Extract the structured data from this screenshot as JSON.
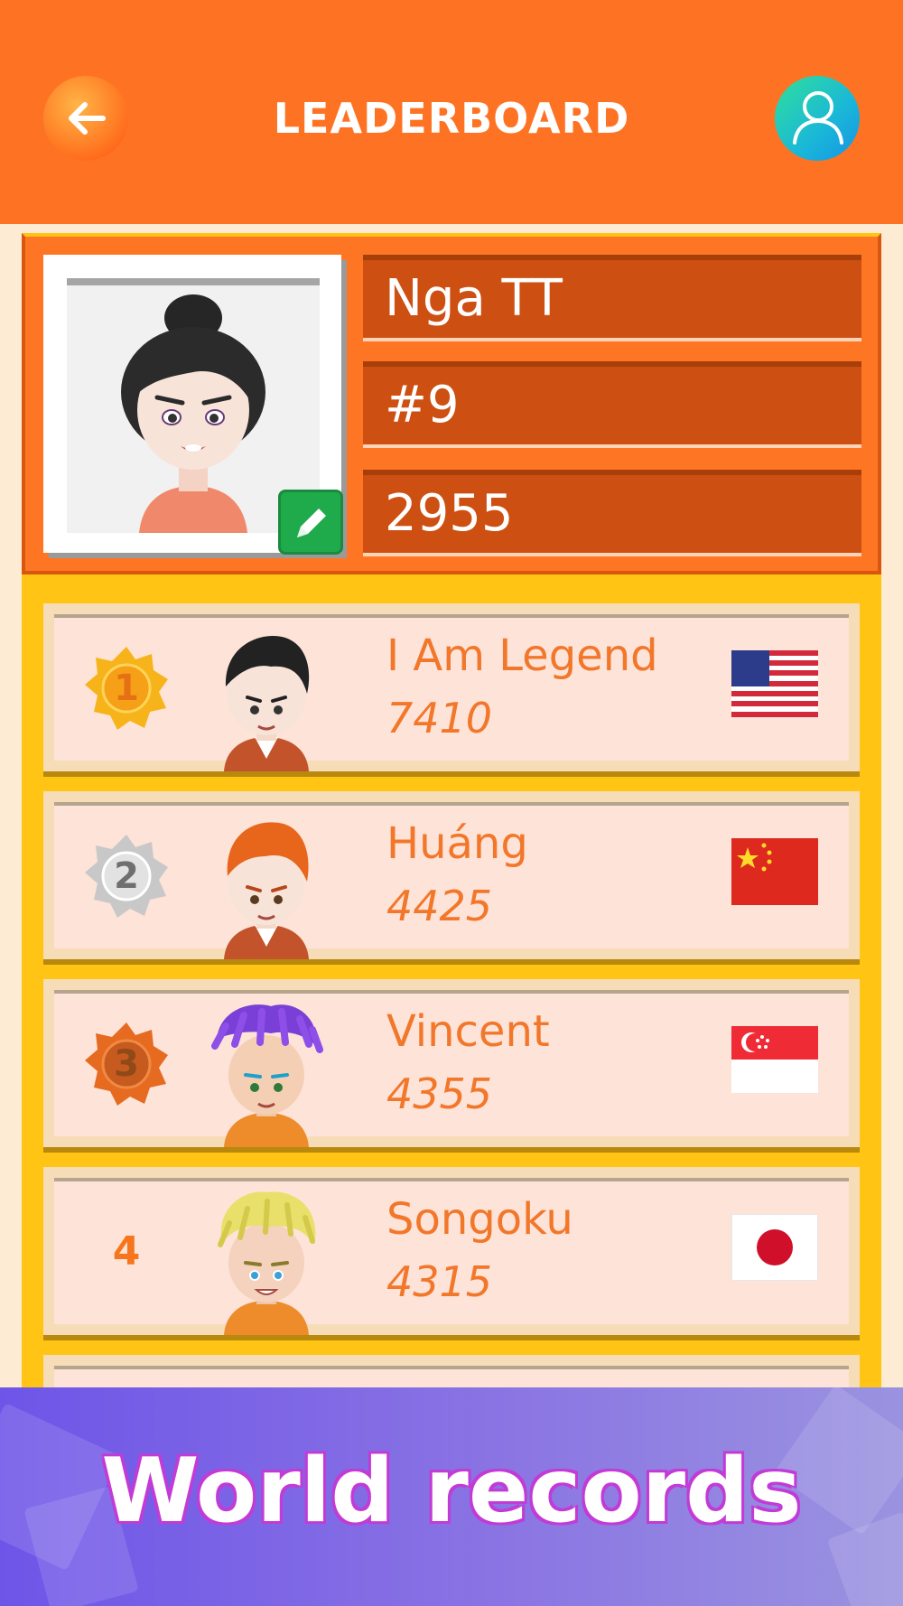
{
  "header": {
    "title": "LEADERBOARD",
    "back_icon": "arrow-left-icon",
    "profile_icon": "user-icon",
    "color": "#fe7323"
  },
  "me": {
    "name": "Nga TT",
    "rank": "#9",
    "score": "2955",
    "edit_icon": "pencil-icon"
  },
  "players": [
    {
      "rank": "1",
      "medal": "gold",
      "name": "I Am Legend",
      "score": "7410",
      "flag": "us-flag"
    },
    {
      "rank": "2",
      "medal": "silver",
      "name": "Huáng",
      "score": "4425",
      "flag": "china-flag"
    },
    {
      "rank": "3",
      "medal": "bronze",
      "name": "Vincent",
      "score": "4355",
      "flag": "singapore-flag"
    },
    {
      "rank": "4",
      "medal": "none",
      "name": "Songoku",
      "score": "4315",
      "flag": "japan-flag"
    }
  ],
  "promo": {
    "text": "World records"
  },
  "colors": {
    "accent": "#fe7323",
    "panel": "#ffc414",
    "name_text": "#f2772a",
    "promo": "#6e55e8"
  }
}
